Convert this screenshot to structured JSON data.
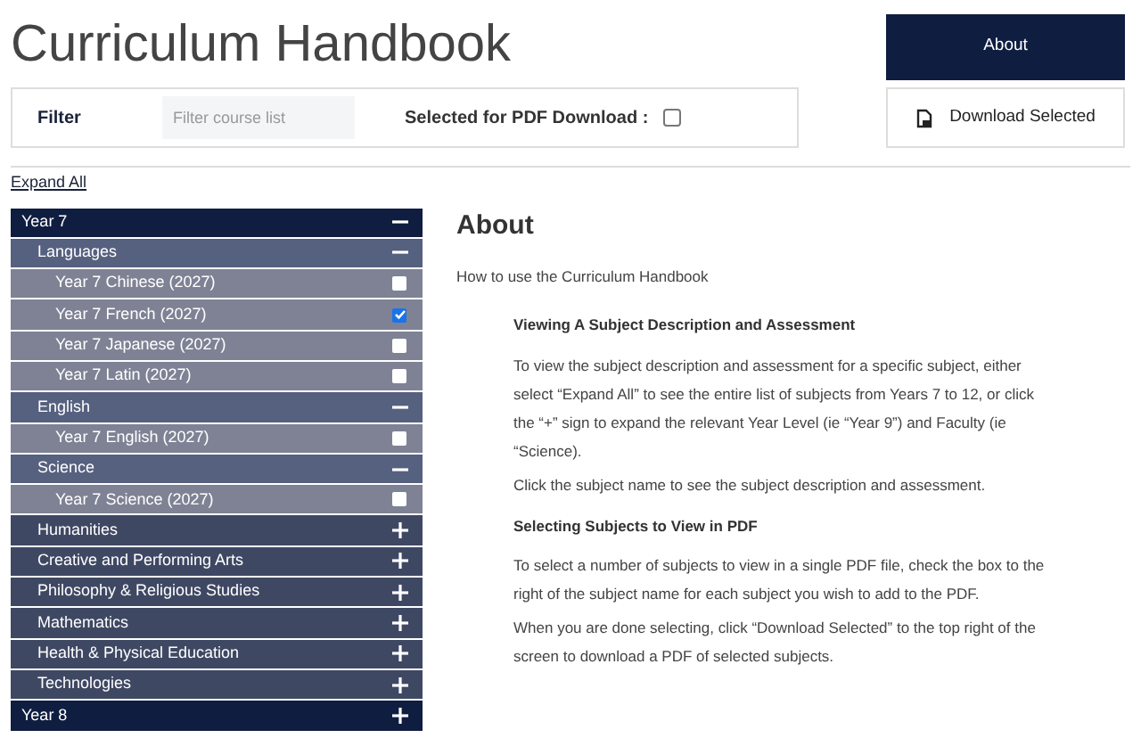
{
  "title": "Curriculum Handbook",
  "about_button": "About",
  "filter": {
    "label": "Filter",
    "placeholder": "Filter course list",
    "pdf_label": "Selected for PDF Download :",
    "pdf_checked": false
  },
  "download_button": "Download Selected",
  "expand_all": "Expand All",
  "tree": [
    {
      "label": "Year 7",
      "expanded": true,
      "children": [
        {
          "label": "Languages",
          "expanded": true,
          "children": [
            {
              "label": "Year 7 Chinese (2027)",
              "checked": false
            },
            {
              "label": "Year 7 French (2027)",
              "checked": true
            },
            {
              "label": "Year 7 Japanese (2027)",
              "checked": false
            },
            {
              "label": "Year 7 Latin (2027)",
              "checked": false
            }
          ]
        },
        {
          "label": "English",
          "expanded": true,
          "children": [
            {
              "label": "Year 7 English (2027)",
              "checked": false
            }
          ]
        },
        {
          "label": "Science",
          "expanded": true,
          "children": [
            {
              "label": "Year 7 Science (2027)",
              "checked": false
            }
          ]
        },
        {
          "label": "Humanities",
          "expanded": false
        },
        {
          "label": "Creative and Performing Arts",
          "expanded": false
        },
        {
          "label": "Philosophy & Religious Studies",
          "expanded": false
        },
        {
          "label": "Mathematics",
          "expanded": false
        },
        {
          "label": "Health & Physical Education",
          "expanded": false
        },
        {
          "label": "Technologies",
          "expanded": false
        }
      ]
    },
    {
      "label": "Year 8",
      "expanded": false
    }
  ],
  "about": {
    "heading": "About",
    "intro": "How to use the Curriculum Handbook",
    "sections": [
      {
        "heading": "Viewing A Subject Description and Assessment",
        "paragraphs": [
          "To view the subject description and assessment for a specific subject, either select “Expand All” to see the entire list of subjects from Years 7 to 12, or click the “+” sign to expand the relevant Year Level (ie “Year 9”) and Faculty (ie “Science).",
          "Click the subject name to see the subject description and assessment."
        ]
      },
      {
        "heading": "Selecting Subjects to View in PDF",
        "paragraphs": [
          "To select a number of subjects to view in a single PDF file, check the box to the right of the subject name for each subject you wish to add to the PDF.",
          "When you are done selecting, click “Download Selected” to the top right of the screen to download a PDF of selected subjects."
        ]
      }
    ]
  }
}
